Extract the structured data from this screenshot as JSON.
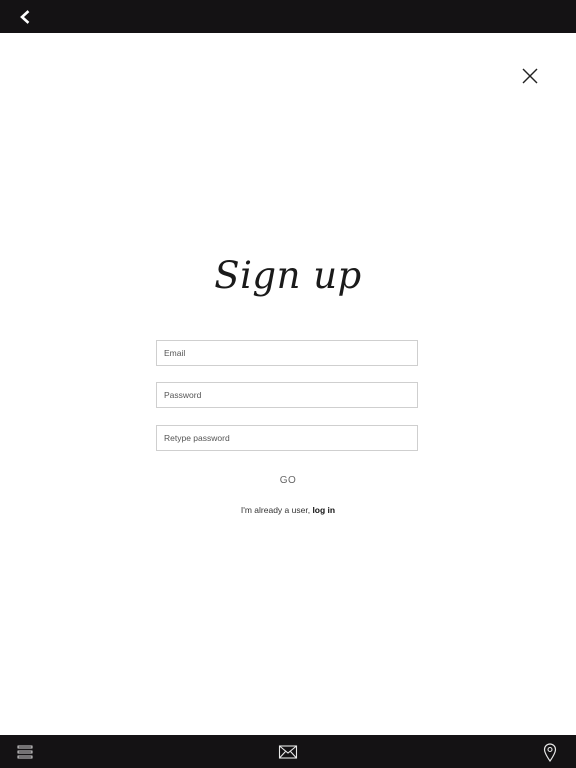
{
  "header": {
    "back_icon": "chevron-left-icon"
  },
  "dialog": {
    "close_icon": "close-icon",
    "title": "Sign up",
    "email_placeholder": "Email",
    "password_placeholder": "Password",
    "retype_placeholder": "Retype password",
    "go_label": "GO",
    "already_user_text": "I'm already a user,",
    "login_link_label": "log in"
  },
  "footer": {
    "menu_icon": "menu-icon",
    "mail_icon": "mail-icon",
    "location_icon": "location-pin-icon"
  },
  "colors": {
    "bar_background": "#141214",
    "page_background": "#ffffff",
    "field_border": "#cfcfcf"
  }
}
